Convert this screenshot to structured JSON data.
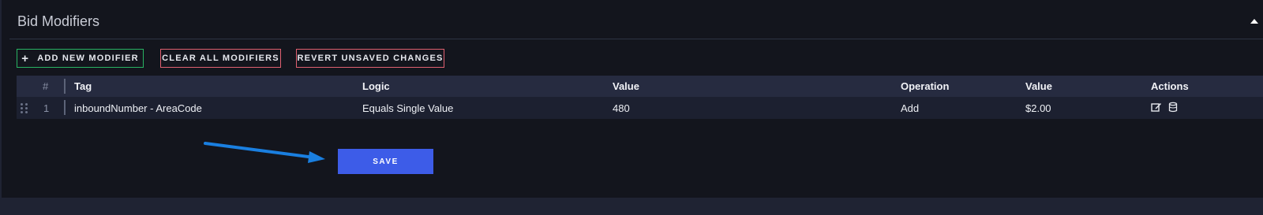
{
  "panel": {
    "title": "Bid Modifiers"
  },
  "toolbar": {
    "add_label": "ADD NEW MODIFIER",
    "clear_label": "CLEAR ALL MODIFIERS",
    "revert_label": "REVERT UNSAVED CHANGES"
  },
  "table": {
    "headers": {
      "number": "#",
      "tag": "Tag",
      "logic": "Logic",
      "value": "Value",
      "operation": "Operation",
      "amount": "Value",
      "actions": "Actions"
    },
    "rows": [
      {
        "number": "1",
        "tag": "inboundNumber - AreaCode",
        "logic": "Equals Single Value",
        "value": "480",
        "operation": "Add",
        "amount": "$2.00"
      }
    ]
  },
  "save_label": "SAVE",
  "colors": {
    "accent": "#3d5ce8",
    "add_border": "#28b463",
    "danger_border": "#e06070",
    "annotation_arrow": "#1a7fe0"
  },
  "icons": {
    "collapse": "caret-up-icon",
    "drag": "drag-handle-icon",
    "edit": "edit-icon",
    "delete": "trash-icon",
    "add": "plus-icon"
  }
}
